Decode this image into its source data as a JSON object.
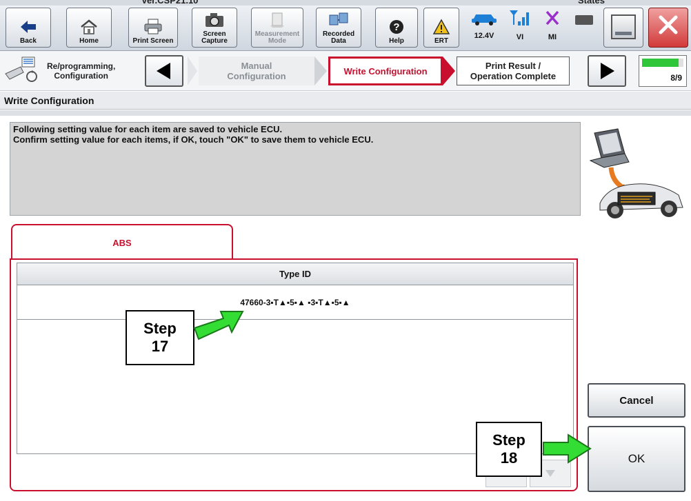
{
  "window": {
    "version": "Ver.CSP21.10",
    "states_label": "States"
  },
  "toolbar": {
    "back": "Back",
    "home": "Home",
    "print_screen": "Print Screen",
    "screen_capture": "Screen\nCapture",
    "measurement_mode": "Measurement\nMode",
    "recorded_data": "Recorded\nData",
    "help": "Help",
    "ert": "ERT",
    "voltage": "12.4V",
    "vi": "VI",
    "mi": "MI"
  },
  "nav": {
    "home_crumb": "Re/programming,\nConfiguration",
    "step_manual": "Manual\nConfiguration",
    "step_write": "Write Configuration",
    "step_print": "Print Result /\nOperation Complete",
    "progress_label": "8/9",
    "progress_fraction": 0.889
  },
  "section": {
    "title": "Write Configuration"
  },
  "message": {
    "line1": "Following setting value for each item are saved to vehicle ECU.",
    "line2": "Confirm setting value for each items, if OK, touch \"OK\" to save them to vehicle ECU."
  },
  "tabs": [
    {
      "label": "ABS"
    }
  ],
  "table": {
    "header": "Type ID",
    "rows": [
      {
        "value": "47660-3▪T▲▪5▪▲ ▪3▪T▲▪5▪▲"
      }
    ]
  },
  "buttons": {
    "cancel": "Cancel",
    "ok": "OK"
  },
  "callouts": {
    "step17": "Step\n17",
    "step18": "Step\n18"
  },
  "colors": {
    "accent_red": "#c8102e",
    "arrow_green": "#33dd33"
  }
}
